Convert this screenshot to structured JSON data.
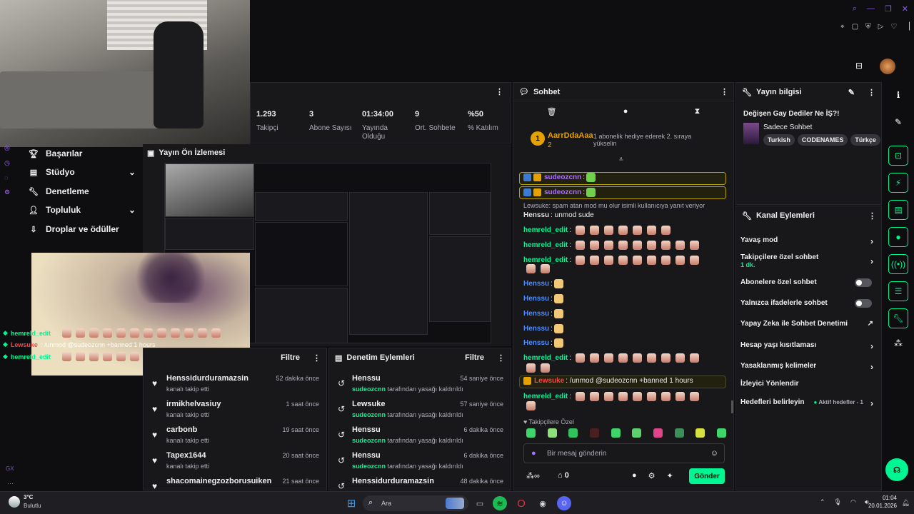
{
  "stats": [
    {
      "value": "1.293",
      "label": "Takipçi"
    },
    {
      "value": "3",
      "label": "Abone Sayısı"
    },
    {
      "value": "01:34:00",
      "label": "Yayında Olduğu"
    },
    {
      "value": "9",
      "label": "Ort. Sohbete"
    },
    {
      "value": "%50",
      "label": "% Katılım"
    }
  ],
  "nav": [
    {
      "label": "Başarılar",
      "icon": "trophy-icon",
      "chevron": false
    },
    {
      "label": "Stüdyo",
      "icon": "studio-icon",
      "chevron": true
    },
    {
      "label": "Denetleme",
      "icon": "wrench-icon",
      "chevron": false
    },
    {
      "label": "Topluluk",
      "icon": "community-icon",
      "chevron": true
    },
    {
      "label": "Droplar ve ödüller",
      "icon": "drops-icon",
      "chevron": false
    }
  ],
  "preview": {
    "title": "Yayın Ön İzlemesi"
  },
  "overlay_chat": [
    {
      "user": "hemreld_edit",
      "text": ":"
    },
    {
      "user": "Lewsuke",
      "text": ": /unmod @sudeozcnn +banned 1 hours"
    },
    {
      "user": "hemreld_edit",
      "text": ":"
    }
  ],
  "activity": {
    "filter_label": "Filtre",
    "rows": [
      {
        "name": "Henssidurduramazsin",
        "sub": "kanalı takip etti",
        "time": "52 dakika önce"
      },
      {
        "name": "irmikhelvasiuy",
        "sub": "kanalı takip etti",
        "time": "1 saat önce"
      },
      {
        "name": "carbonb",
        "sub": "kanalı takip etti",
        "time": "19 saat önce"
      },
      {
        "name": "Tapex1644",
        "sub": "kanalı takip etti",
        "time": "20 saat önce"
      },
      {
        "name": "shacomainegzozborusuiken",
        "sub": "",
        "time": "21 saat önce"
      }
    ]
  },
  "mod_actions": {
    "title": "Denetim Eylemleri",
    "filter_label": "Filtre",
    "rows": [
      {
        "name": "Henssu",
        "target": "sudeozcnn",
        "sub": "tarafından yasağı kaldırıldı",
        "time": "54 saniye önce"
      },
      {
        "name": "Lewsuke",
        "target": "sudeozcnn",
        "sub": "tarafından yasağı kaldırıldı",
        "time": "57 saniye önce"
      },
      {
        "name": "Henssu",
        "target": "sudeozcnn",
        "sub": "tarafından yasağı kaldırıldı",
        "time": "6 dakika önce"
      },
      {
        "name": "Henssu",
        "target": "sudeozcnn",
        "sub": "tarafından yasağı kaldırıldı",
        "time": "6 dakika önce"
      },
      {
        "name": "Henssidurduramazsin",
        "target": "",
        "sub": "",
        "time": "48 dakika önce"
      }
    ]
  },
  "chat": {
    "title": "Sohbet",
    "pinned_user": "AarrDdaAaa",
    "pinned_count": "2",
    "pinned_text": "1 abonelik hediye ederek 2. sıraya yükselin",
    "reply_note": "Lewsuke: spam atan mod mu olur isimli kullanıcıya yanıt veriyor",
    "messages": [
      {
        "user": "sudeozcnn",
        "text": ":"
      },
      {
        "user": "sudeozcnn",
        "text": ":"
      },
      {
        "user": "Henssu",
        "text": ": unmod sude"
      },
      {
        "user": "hemreld_edit",
        "text": ":"
      },
      {
        "user": "hemreld_edit",
        "text": ":"
      },
      {
        "user": "hemreld_edit",
        "text": ":"
      },
      {
        "user": "Henssu",
        "text": ":"
      },
      {
        "user": "Henssu",
        "text": ":"
      },
      {
        "user": "Henssu",
        "text": ":"
      },
      {
        "user": "Henssu",
        "text": ":"
      },
      {
        "user": "Henssu",
        "text": ":"
      },
      {
        "user": "hemreld_edit",
        "text": ":"
      },
      {
        "user": "Lewsuke",
        "text": ": /unmod @sudeozcnn +banned 1 hours"
      },
      {
        "user": "hemreld_edit",
        "text": ":"
      }
    ],
    "followers_only": "Takipçilere Özel",
    "input_placeholder": "Bir mesaj gönderin",
    "points": "0",
    "send_label": "Gönder"
  },
  "stream_info": {
    "header": "Yayın bilgisi",
    "title": "Değişen Gay Dediler Ne İŞ?!",
    "category": "Sadece Sohbet",
    "tags": [
      "Turkish",
      "CODENAMES",
      "Türkçe"
    ]
  },
  "channel_actions": {
    "header": "Kanal Eylemleri",
    "items": [
      {
        "label": "Yavaş mod",
        "kind": "chevron",
        "sub": "",
        "extra": ""
      },
      {
        "label": "Takipçilere özel sohbet",
        "kind": "chevron",
        "sub": "1 dk.",
        "extra": ""
      },
      {
        "label": "Abonelere özel sohbet",
        "kind": "toggle",
        "sub": "",
        "extra": ""
      },
      {
        "label": "Yalnızca ifadelerle sohbet",
        "kind": "toggle",
        "sub": "",
        "extra": ""
      },
      {
        "label": "Yapay Zeka ile Sohbet Denetimi",
        "kind": "external",
        "sub": "",
        "extra": ""
      },
      {
        "label": "Hesap yaşı kısıtlaması",
        "kind": "chevron",
        "sub": "",
        "extra": ""
      },
      {
        "label": "Yasaklanmış kelimeler",
        "kind": "chevron",
        "sub": "",
        "extra": ""
      },
      {
        "label": "İzleyici Yönlendir",
        "kind": "none",
        "sub": "",
        "extra": ""
      },
      {
        "label": "Hedefleri belirleyin",
        "kind": "chevron",
        "sub": "",
        "extra": "Aktif hedefler - 1"
      }
    ]
  },
  "taskbar": {
    "weather_temp": "3°C",
    "weather_desc": "Bulutlu",
    "search_placeholder": "Ara",
    "time": "01:04",
    "date": "20.01.2026"
  },
  "colors": {
    "accent": "#00f593",
    "bg": "#0e0e10",
    "panel": "#18181b"
  }
}
